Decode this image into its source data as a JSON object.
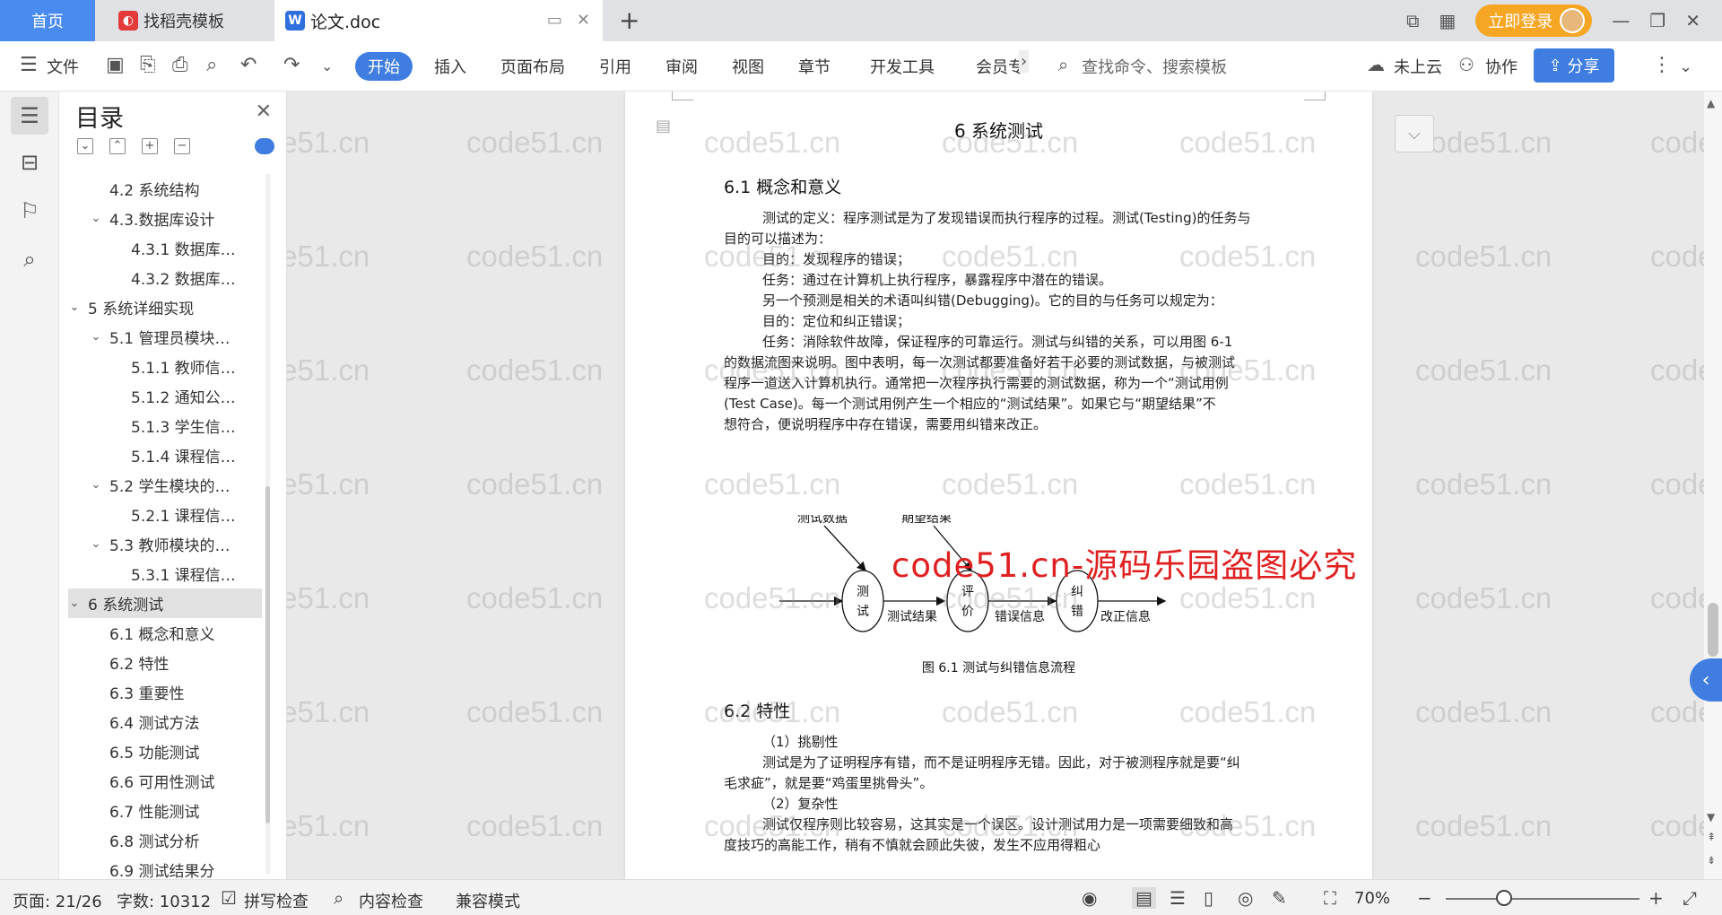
{
  "tabs": {
    "home": "首页",
    "docer": "找稻壳模板",
    "doc": "论文.doc",
    "new_tab": "+"
  },
  "account": {
    "login": "立即登录"
  },
  "menu": {
    "file": "文件",
    "start": "开始",
    "items": [
      "插入",
      "页面布局",
      "引用",
      "审阅",
      "视图",
      "章节",
      "开发工具",
      "会员专"
    ],
    "search_placeholder": "查找命令、搜索模板",
    "cloud": "未上云",
    "collab": "协作",
    "share": "分享"
  },
  "outline": {
    "title": "目录",
    "items": [
      {
        "label": "4.2 系统结构",
        "level": 2
      },
      {
        "label": "4.3.数据库设计",
        "level": 2,
        "expanded": true
      },
      {
        "label": "4.3.1 数据库…",
        "level": 3
      },
      {
        "label": "4.3.2 数据库…",
        "level": 3
      },
      {
        "label": "5 系统详细实现",
        "level": 1,
        "expanded": true
      },
      {
        "label": "5.1 管理员模块…",
        "level": 2,
        "expanded": true
      },
      {
        "label": "5.1.1 教师信…",
        "level": 3
      },
      {
        "label": "5.1.2 通知公…",
        "level": 3
      },
      {
        "label": "5.1.3 学生信…",
        "level": 3
      },
      {
        "label": "5.1.4 课程信…",
        "level": 3
      },
      {
        "label": "5.2 学生模块的…",
        "level": 2,
        "expanded": true
      },
      {
        "label": "5.2.1 课程信…",
        "level": 3
      },
      {
        "label": "5.3 教师模块的…",
        "level": 2,
        "expanded": true
      },
      {
        "label": "5.3.1 课程信…",
        "level": 3
      },
      {
        "label": "6 系统测试",
        "level": 1,
        "expanded": true,
        "selected": true
      },
      {
        "label": "6.1 概念和意义",
        "level": 2
      },
      {
        "label": "6.2 特性",
        "level": 2
      },
      {
        "label": "6.3 重要性",
        "level": 2
      },
      {
        "label": "6.4 测试方法",
        "level": 2
      },
      {
        "label": "6.5 功能测试",
        "level": 2
      },
      {
        "label": "6.6 可用性测试",
        "level": 2
      },
      {
        "label": "6.7 性能测试",
        "level": 2
      },
      {
        "label": "6.8 测试分析",
        "level": 2
      },
      {
        "label": "6.9 测试结果分",
        "level": 2
      }
    ]
  },
  "document": {
    "chapter_title": "6 系统测试",
    "sec1_title": "6.1 概念和意义",
    "sec1_paras": [
      "测试的定义：程序测试是为了发现错误而执行程序的过程。测试(Testing)的任务与",
      "目的可以描述为：",
      "目的：发现程序的错误；",
      "任务：通过在计算机上执行程序，暴露程序中潜在的错误。",
      "另一个预测是相关的术语叫纠错(Debugging)。它的目的与任务可以规定为：",
      "目的：定位和纠正错误；",
      "任务：消除软件故障，保证程序的可靠运行。测试与纠错的关系，可以用图 6-1",
      "的数据流图来说明。图中表明，每一次测试都要准备好若干必要的测试数据，与被测试",
      "程序一道送入计算机执行。通常把一次程序执行需要的测试数据，称为一个“测试用例",
      "(Test Case)。每一个测试用例产生一个相应的“测试结果”。如果它与“期望结果”不",
      "想符合，便说明程序中存在错误，需要用纠错来改正。"
    ],
    "diagram": {
      "in_data": "测试数据",
      "expected": "期望结果",
      "node_test": [
        "测",
        "试"
      ],
      "node_eval": [
        "评",
        "价"
      ],
      "node_fix": [
        "纠",
        "错"
      ],
      "edge_result": "测试结果",
      "edge_error": "错误信息",
      "edge_fix": "改正信息"
    },
    "figure_caption": "图 6.1 测试与纠错信息流程",
    "sec2_title": "6.2 特性",
    "sec2_paras": [
      "（1）挑剔性",
      "测试是为了证明程序有错，而不是证明程序无错。因此，对于被测程序就是要“纠",
      "毛求疵”，就是要“鸡蛋里挑骨头”。",
      "（2）复杂性",
      "测试仅程序则比较容易，这其实是一个误区。设计测试用力是一项需要细致和高",
      "度技巧的高能工作，稍有不慎就会顾此失彼，发生不应用得粗心"
    ],
    "watermark": "code51.cn",
    "red_watermark": "code51.cn-源码乐园盗图必究"
  },
  "status": {
    "page": "页面: 21/26",
    "words": "字数: 10312",
    "spell": "拼写检查",
    "content_check": "内容检查",
    "compat": "兼容模式",
    "zoom": "70%",
    "zoom_level": 0.3
  },
  "colors": {
    "accent": "#3f7de0",
    "login": "#f5a623",
    "red_mark": "#e02020"
  }
}
